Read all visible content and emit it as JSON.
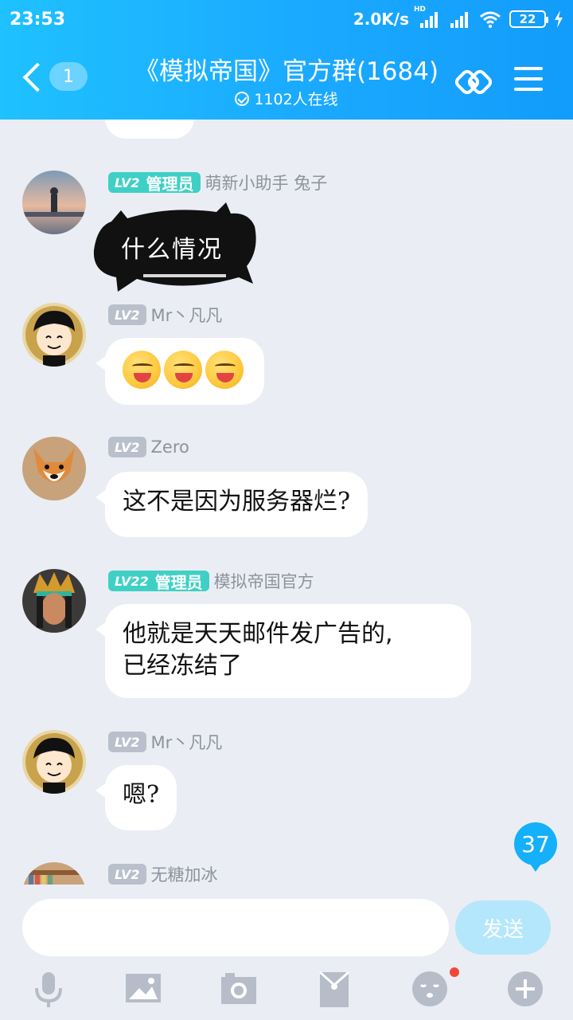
{
  "status_bar": {
    "time": "23:53",
    "network_speed": "2.0K/s",
    "hd_label": "HD",
    "battery": "22"
  },
  "header": {
    "unread_count": "1",
    "title": "《模拟帝国》官方群(1684)",
    "online": "1102人在线"
  },
  "messages": [
    {
      "level": "LV2",
      "role": "管理员",
      "nickname": "萌新小助手 兔子",
      "sticker_text": "什么情况"
    },
    {
      "level": "LV2",
      "role": "",
      "nickname": "Mr丶凡凡"
    },
    {
      "level": "LV2",
      "role": "",
      "nickname": "Zero",
      "text": "这不是因为服务器烂?"
    },
    {
      "level": "LV22",
      "role": "管理员",
      "nickname": "模拟帝国官方",
      "text_line1": "他就是天天邮件发广告的,",
      "text_line2": "已经冻结了"
    },
    {
      "level": "LV2",
      "role": "",
      "nickname": "Mr丶凡凡",
      "text": "嗯?"
    },
    {
      "level": "LV2",
      "role": "",
      "nickname": "无糖加冰"
    }
  ],
  "new_messages_badge": "37",
  "input_bar": {
    "send_label": "发送",
    "input_value": ""
  },
  "colors": {
    "header_gradient_start": "#1fc1ff",
    "header_gradient_end": "#129cfb",
    "admin_badge": "#3fd0c5",
    "level_badge": "#b9c0cc",
    "send_button": "#b4e7fb"
  },
  "toolbar_icons": [
    "microphone-icon",
    "image-icon",
    "camera-icon",
    "red-packet-icon",
    "emoji-face-icon",
    "plus-icon"
  ]
}
